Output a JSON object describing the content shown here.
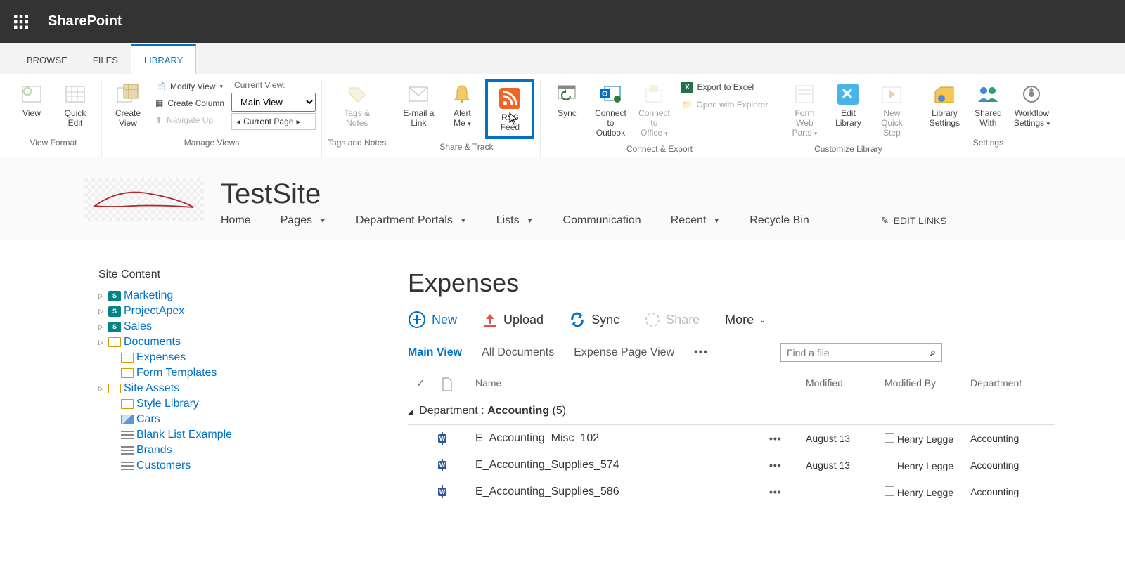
{
  "topbar": {
    "brand": "SharePoint"
  },
  "tabs": {
    "browse": "BROWSE",
    "files": "FILES",
    "library": "LIBRARY"
  },
  "ribbon": {
    "view_format": {
      "label": "View Format",
      "view": "View",
      "quick_edit": "Quick\nEdit"
    },
    "manage_views": {
      "label": "Manage Views",
      "create_view": "Create\nView",
      "modify_view": "Modify View",
      "create_column": "Create Column",
      "navigate_up": "Navigate Up",
      "current_view_label": "Current View:",
      "current_view_value": "Main View",
      "current_page": "Current Page"
    },
    "tags_notes": {
      "label": "Tags and Notes",
      "btn": "Tags &\nNotes"
    },
    "share_track": {
      "label": "Share & Track",
      "email": "E-mail a\nLink",
      "alert": "Alert\nMe",
      "rss": "RSS\nFeed"
    },
    "connect_export": {
      "label": "Connect & Export",
      "sync": "Sync",
      "outlook": "Connect to\nOutlook",
      "office": "Connect to\nOffice",
      "export_excel": "Export to Excel",
      "open_explorer": "Open with Explorer"
    },
    "customize": {
      "label": "Customize Library",
      "form_web_parts": "Form Web\nParts",
      "edit_library": "Edit\nLibrary",
      "new_quick_step": "New Quick\nStep"
    },
    "settings": {
      "label": "Settings",
      "library_settings": "Library\nSettings",
      "shared_with": "Shared\nWith",
      "workflow": "Workflow\nSettings"
    }
  },
  "site": {
    "title": "TestSite",
    "nav": [
      "Home",
      "Pages",
      "Department Portals",
      "Lists",
      "Communication",
      "Recent",
      "Recycle Bin"
    ],
    "nav_has_dd": [
      false,
      true,
      true,
      true,
      false,
      true,
      false
    ],
    "edit_links": "EDIT LINKS"
  },
  "leftnav": {
    "header": "Site Content",
    "items": [
      {
        "label": "Marketing",
        "icon": "sp-sub",
        "tri": true,
        "indent": 0
      },
      {
        "label": "ProjectApex",
        "icon": "sp-sub",
        "tri": true,
        "indent": 0
      },
      {
        "label": "Sales",
        "icon": "sp-sub",
        "tri": true,
        "indent": 0
      },
      {
        "label": "Documents",
        "icon": "folder",
        "tri": true,
        "indent": 0
      },
      {
        "label": "Expenses",
        "icon": "folder",
        "tri": false,
        "indent": 1
      },
      {
        "label": "Form Templates",
        "icon": "folder",
        "tri": false,
        "indent": 1
      },
      {
        "label": "Site Assets",
        "icon": "folder",
        "tri": true,
        "indent": 0
      },
      {
        "label": "Style Library",
        "icon": "folder",
        "tri": false,
        "indent": 1
      },
      {
        "label": "Cars",
        "icon": "pic",
        "tri": false,
        "indent": 1
      },
      {
        "label": "Blank List Example",
        "icon": "list",
        "tri": false,
        "indent": 1
      },
      {
        "label": "Brands",
        "icon": "list",
        "tri": false,
        "indent": 1
      },
      {
        "label": "Customers",
        "icon": "list",
        "tri": false,
        "indent": 1
      }
    ]
  },
  "library": {
    "title": "Expenses",
    "actions": {
      "new": "New",
      "upload": "Upload",
      "sync": "Sync",
      "share": "Share",
      "more": "More"
    },
    "views": [
      "Main View",
      "All Documents",
      "Expense Page View"
    ],
    "find_placeholder": "Find a file",
    "columns": {
      "name": "Name",
      "modified": "Modified",
      "modified_by": "Modified By",
      "department": "Department"
    },
    "group": {
      "label": "Department :",
      "value": "Accounting",
      "count": "(5)"
    },
    "rows": [
      {
        "name": "E_Accounting_Misc_102",
        "modified": "August 13",
        "by": "Henry Legge",
        "dept": "Accounting"
      },
      {
        "name": "E_Accounting_Supplies_574",
        "modified": "August 13",
        "by": "Henry Legge",
        "dept": "Accounting"
      },
      {
        "name": "E_Accounting_Supplies_586",
        "modified": "",
        "by": "Henry Legge",
        "dept": "Accounting"
      }
    ]
  }
}
